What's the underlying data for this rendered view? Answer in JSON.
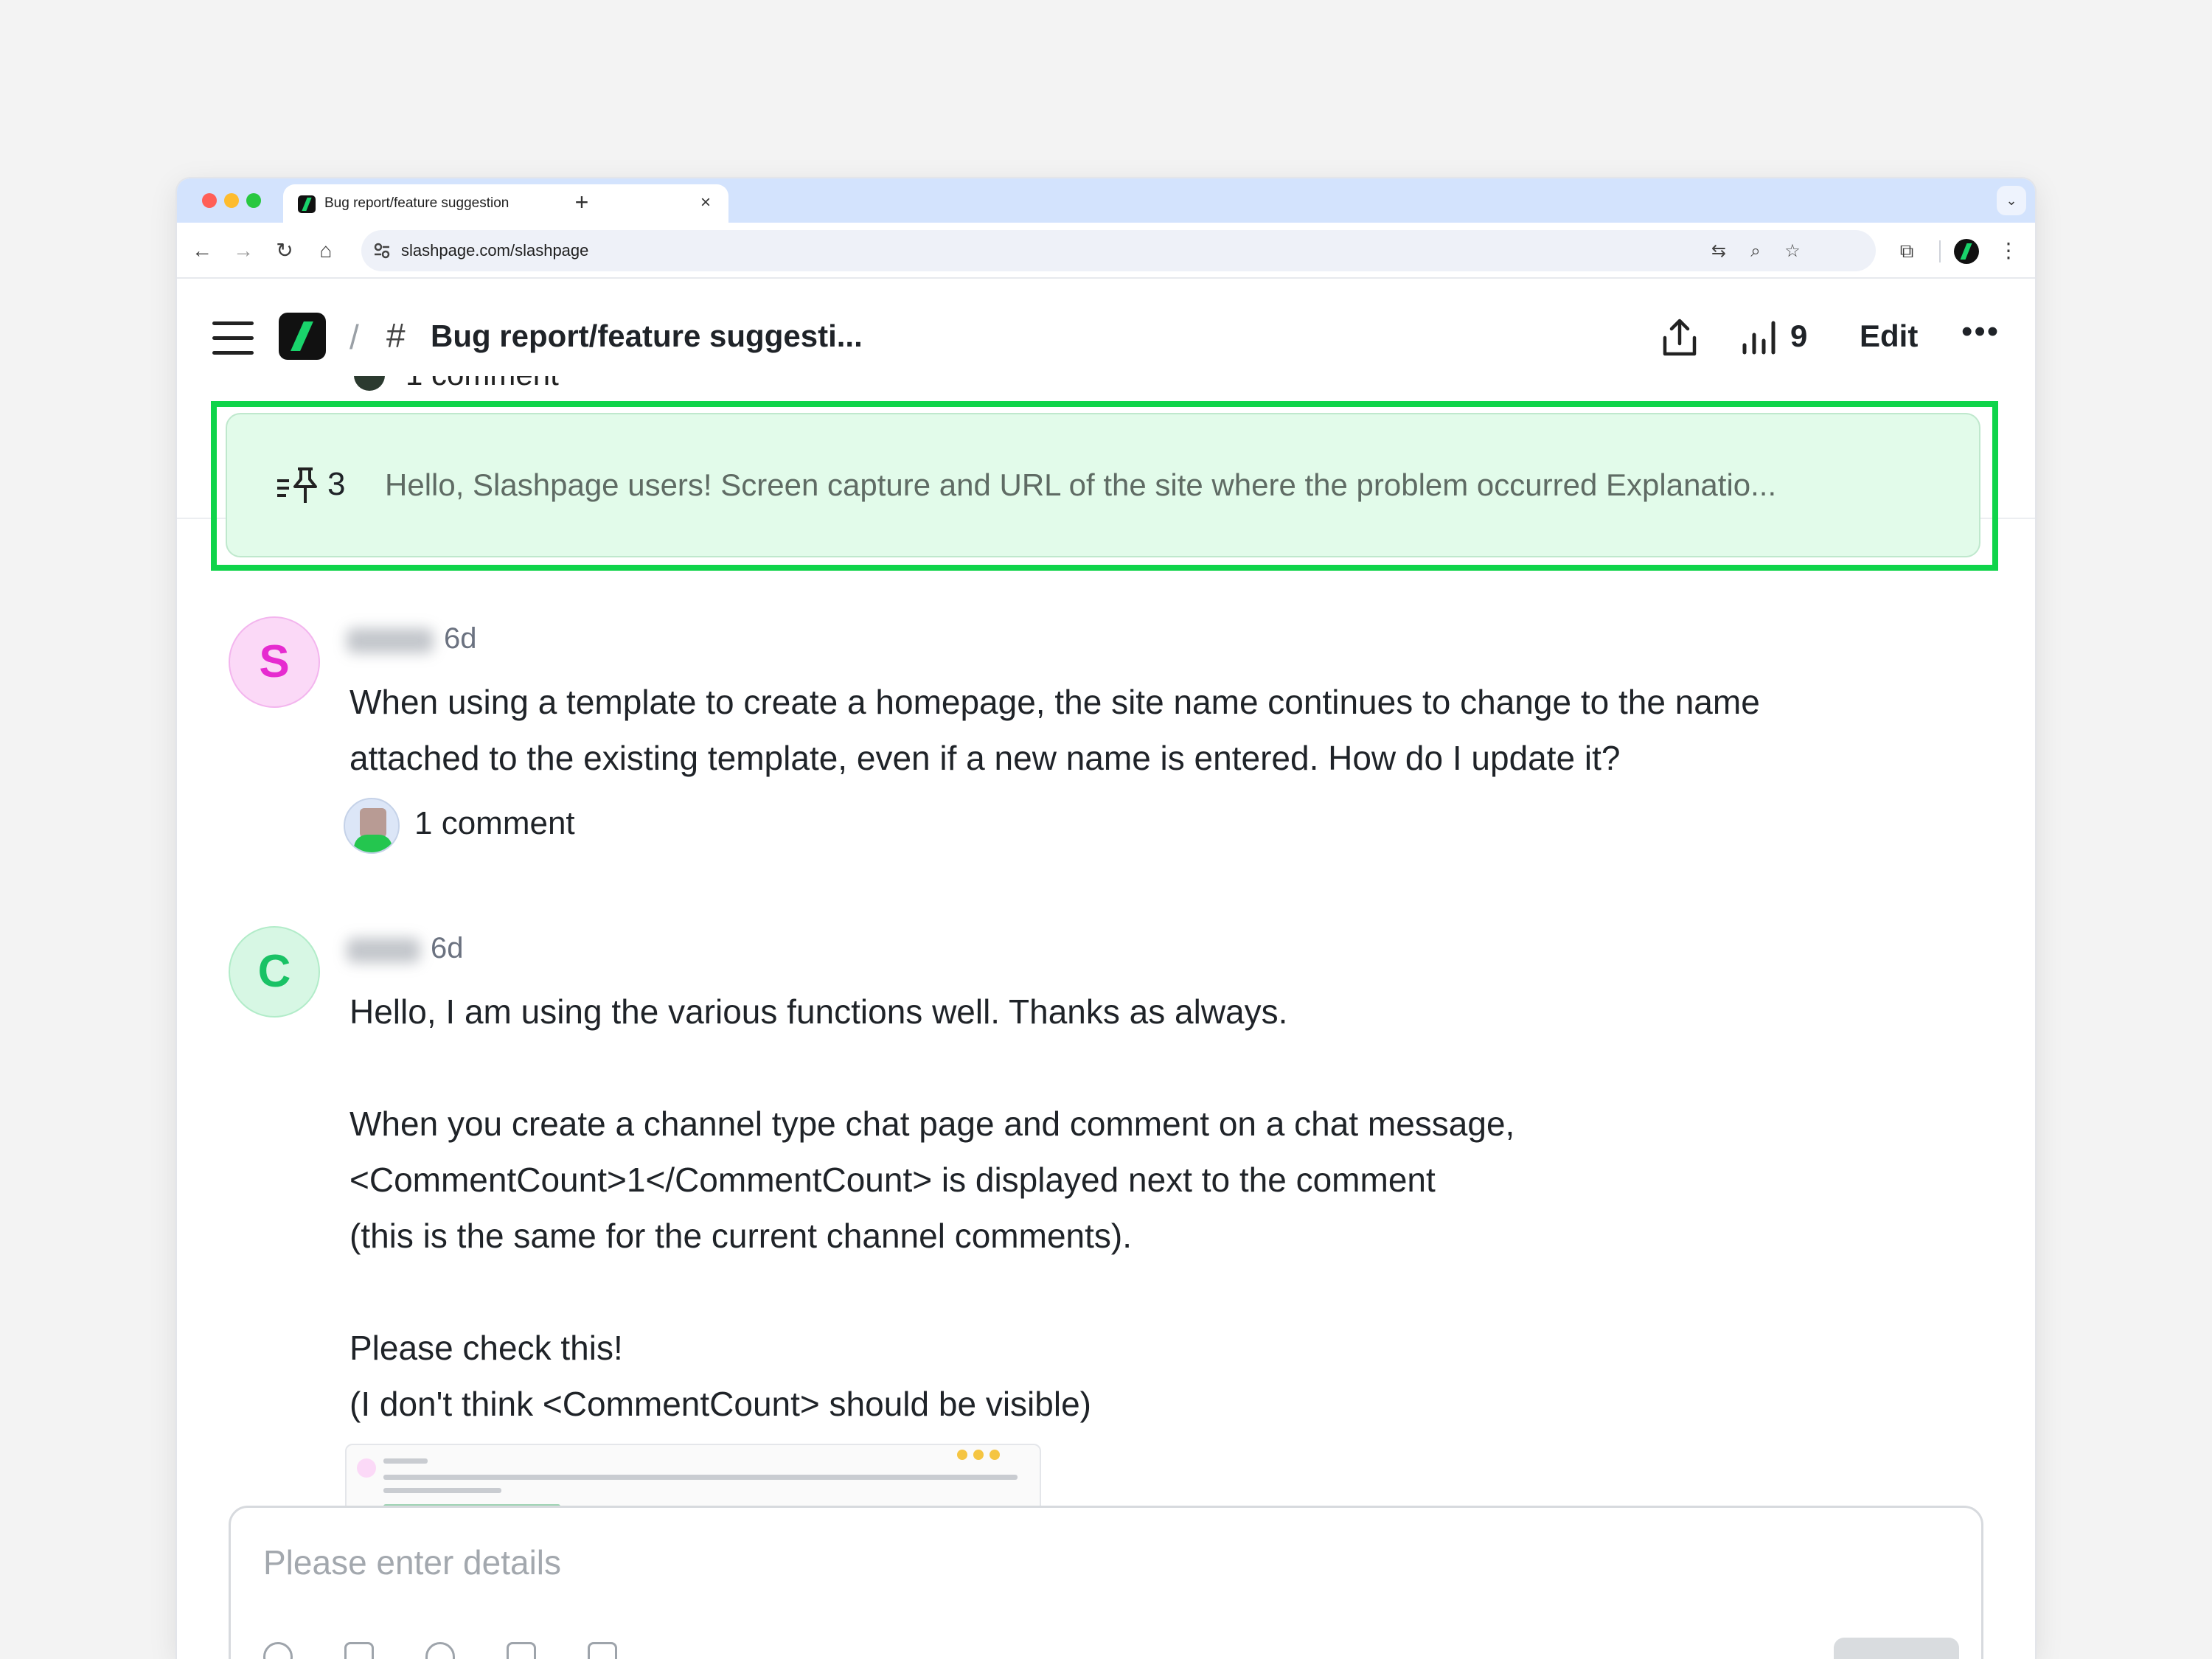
{
  "browser": {
    "tab_title": "Bug report/feature suggestion",
    "url": "slashpage.com/slashpage"
  },
  "header": {
    "title": "Bug report/feature suggesti...",
    "crumb_separator": "/",
    "view_count": "9",
    "edit_label": "Edit",
    "more_label": "•••"
  },
  "previous_post": {
    "comment_label": "1 comment"
  },
  "pinned": {
    "count": "3",
    "text": "Hello, Slashpage users! Screen capture and URL of the site where the problem occurred Explanatio..."
  },
  "posts": [
    {
      "avatar_letter": "S",
      "time": "6d",
      "body": "When using a template to create a homepage, the site name continues to change to the name\nattached to the existing template, even if a new name is entered. How do I update it?",
      "comment_label": "1 comment"
    },
    {
      "avatar_letter": "C",
      "time": "6d",
      "body": "Hello, I am using the various functions well. Thanks as always.\n\nWhen you create a channel type chat page and comment on a chat message,\n<CommentCount>1</CommentCount> is displayed next to the comment\n(this is the same for the current channel comments).\n\nPlease check this!\n(I don't think <CommentCount> should be visible)"
    }
  ],
  "composer": {
    "placeholder": "Please enter details"
  },
  "colors": {
    "highlight": "#0fd44a",
    "pinned_bg": "#e2fbea",
    "brand_green": "#19d36b",
    "avatar_s": "#e62bd0",
    "avatar_c": "#19c265"
  },
  "icons": {
    "tab_close": "×",
    "new_tab": "+",
    "hash": "#"
  }
}
